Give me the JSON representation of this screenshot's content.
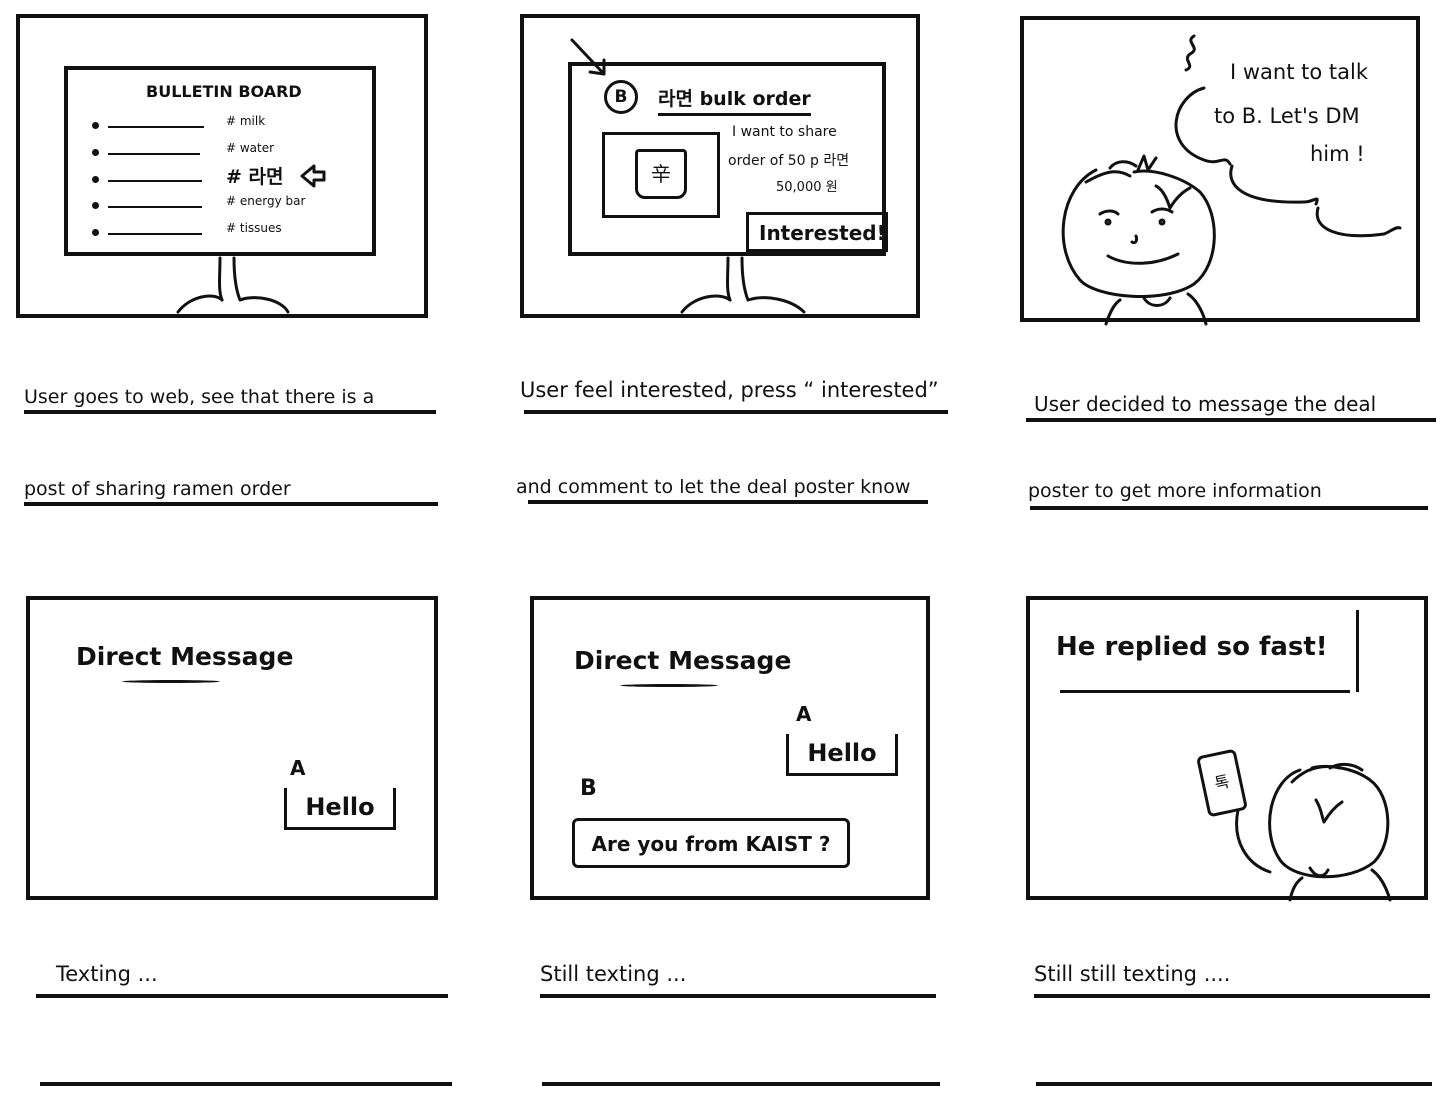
{
  "panels": {
    "p1": {
      "board_title": "BULLETIN BOARD",
      "tags": [
        "# milk",
        "# water",
        "# 라면",
        "# energy bar",
        "# tissues"
      ],
      "caption_line1": "User goes to web, see that there is a",
      "caption_line2": "post of sharing ramen order"
    },
    "p2": {
      "avatar_letter": "B",
      "post_title": "라면 bulk order",
      "post_text_1": "I want to share",
      "post_text_2": "order of 50 p 라면",
      "post_text_3": "50,000 원",
      "product_label": "辛",
      "interested_button": "Interested!",
      "caption_line1": "User feel interested, press “ interested”",
      "caption_line2": "and comment to let the deal poster know"
    },
    "p3": {
      "thought_1": "I want to talk",
      "thought_2": "to B. Let's DM",
      "thought_3": "him !",
      "caption_line1": "User decided to  message the deal",
      "caption_line2": "poster to get more information"
    },
    "p4": {
      "title": "Direct Message",
      "sender_a": "A",
      "msg_a": "Hello",
      "caption_line1": "Texting ...",
      "caption_line2": ""
    },
    "p5": {
      "title": "Direct Message",
      "sender_a": "A",
      "msg_a": "Hello",
      "sender_b": "B",
      "msg_b": "Are you from KAIST ?",
      "caption_line1": "Still texting ...",
      "caption_line2": ""
    },
    "p6": {
      "exclaim": "He replied so fast!",
      "phone_label": "톡",
      "caption_line1": "Still still texting ....",
      "caption_line2": ""
    }
  }
}
